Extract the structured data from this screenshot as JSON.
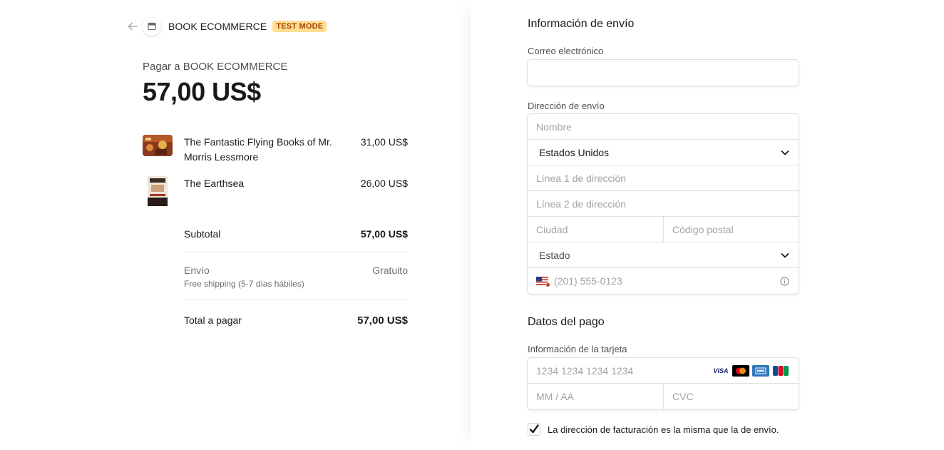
{
  "header": {
    "store_name": "BOOK ECOMMERCE",
    "badge": "TEST MODE"
  },
  "summary": {
    "pay_to": "Pagar a BOOK ECOMMERCE",
    "amount": "57,00 US$",
    "items": [
      {
        "name": "The Fantastic Flying Books of Mr. Morris Lessmore",
        "price": "31,00 US$"
      },
      {
        "name": "The Earthsea",
        "price": "26,00 US$"
      }
    ],
    "subtotal_label": "Subtotal",
    "subtotal_value": "57,00 US$",
    "shipping_label": "Envío",
    "shipping_detail": "Free shipping (5-7 días hábiles)",
    "shipping_value": "Gratuito",
    "total_label": "Total a pagar",
    "total_value": "57,00 US$"
  },
  "shipping_form": {
    "title": "Información de envío",
    "email_label": "Correo electrónico",
    "email_value": "",
    "address_label": "Dirección de envío",
    "name_placeholder": "Nombre",
    "country": "Estados Unidos",
    "line1_placeholder": "Línea 1 de dirección",
    "line2_placeholder": "Línea 2 de dirección",
    "city_placeholder": "Ciudad",
    "postal_placeholder": "Código postal",
    "state_placeholder": "Estado",
    "phone_placeholder": "(201) 555-0123"
  },
  "payment_form": {
    "title": "Datos del pago",
    "card_label": "Información de la tarjeta",
    "card_number_placeholder": "1234 1234 1234 1234",
    "expiry_placeholder": "MM / AA",
    "cvc_placeholder": "CVC",
    "card_brands": [
      "VISA",
      "mastercard-icon",
      "amex-icon",
      "jcb-icon"
    ],
    "billing_same_label": "La dirección de facturación es la misma que la de envío.",
    "billing_same_checked": true
  },
  "colors": {
    "badge_bg": "#ffde92",
    "badge_text": "#a74203",
    "visa_blue": "#1a1f71",
    "amex_blue": "#2e77bc"
  }
}
